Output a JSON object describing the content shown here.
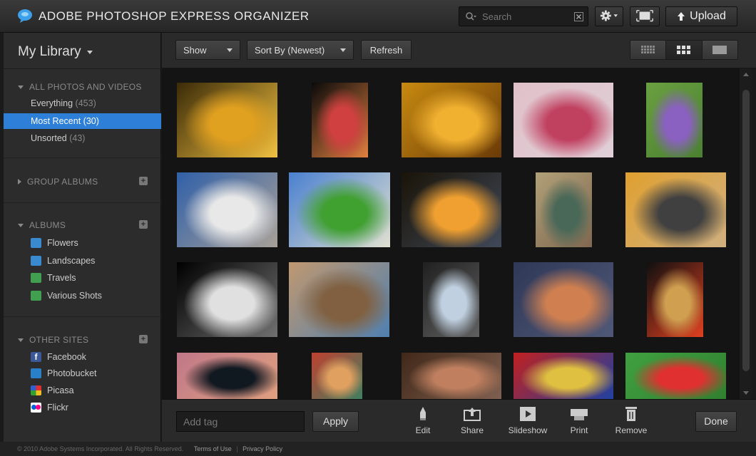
{
  "header": {
    "title": "ADOBE PHOTOSHOP EXPRESS ORGANIZER",
    "search_placeholder": "Search",
    "upload_label": "Upload",
    "logo_icon": "photoshop-express-logo",
    "accent": "#2d7fd8"
  },
  "sidebar": {
    "library_title": "My Library",
    "all_section": {
      "title": "ALL PHOTOS AND VIDEOS",
      "items": [
        {
          "label": "Everything",
          "count": "(453)"
        },
        {
          "label": "Most Recent",
          "count": "(30)",
          "selected": true
        },
        {
          "label": "Unsorted",
          "count": "(43)"
        }
      ]
    },
    "group_albums": {
      "title": "GROUP ALBUMS"
    },
    "albums": {
      "title": "ALBUMS",
      "items": [
        {
          "label": "Flowers",
          "icon": "album-icon"
        },
        {
          "label": "Landscapes",
          "icon": "album-icon"
        },
        {
          "label": "Travels",
          "icon": "album-icon"
        },
        {
          "label": "Various Shots",
          "icon": "album-icon"
        }
      ]
    },
    "other_sites": {
      "title": "OTHER SITES",
      "items": [
        {
          "label": "Facebook",
          "icon": "facebook-icon"
        },
        {
          "label": "Photobucket",
          "icon": "photobucket-icon"
        },
        {
          "label": "Picasa",
          "icon": "picasa-icon"
        },
        {
          "label": "Flickr",
          "icon": "flickr-icon"
        }
      ]
    }
  },
  "toolbar": {
    "show_label": "Show",
    "sort_label": "Sort By (Newest)",
    "refresh_label": "Refresh",
    "view_modes": [
      "small-thumbnails",
      "medium-thumbnails",
      "large-view"
    ],
    "active_view": "medium-thumbnails"
  },
  "grid": {
    "photos": [
      {
        "name": "yellow-flower",
        "colors": [
          "#3a2a08",
          "#e0a020",
          "#f0c040"
        ]
      },
      {
        "name": "red-tulips",
        "colors": [
          "#0a0a0a",
          "#d04040",
          "#e08040"
        ]
      },
      {
        "name": "paper-umbrella",
        "colors": [
          "#c88a10",
          "#f0b030",
          "#6a3a08"
        ]
      },
      {
        "name": "orchid",
        "colors": [
          "#e0c0c8",
          "#c04060",
          "#e0d0d8"
        ]
      },
      {
        "name": "purple-daisy",
        "colors": [
          "#6aa040",
          "#8a60c0",
          "#4a8030"
        ]
      },
      {
        "name": "arch-building",
        "colors": [
          "#3060a8",
          "#e8e8e8",
          "#a8a098"
        ]
      },
      {
        "name": "white-church",
        "colors": [
          "#4a80d0",
          "#40a030",
          "#e0e0d0"
        ]
      },
      {
        "name": "pagoda-sunset",
        "colors": [
          "#1a1408",
          "#f0a030",
          "#404858"
        ]
      },
      {
        "name": "green-doors",
        "colors": [
          "#b0a078",
          "#4a6858",
          "#806850"
        ]
      },
      {
        "name": "fisherman",
        "colors": [
          "#e0a030",
          "#404040",
          "#d0b080"
        ]
      },
      {
        "name": "boat-silhouette",
        "colors": [
          "#000000",
          "#e0e0e0",
          "#707070"
        ]
      },
      {
        "name": "old-street",
        "colors": [
          "#c09870",
          "#806040",
          "#5080b0"
        ]
      },
      {
        "name": "temple-arch",
        "colors": [
          "#202020",
          "#c0d0e0",
          "#606060"
        ]
      },
      {
        "name": "cloudy-sky",
        "colors": [
          "#303858",
          "#d08050",
          "#505878"
        ]
      },
      {
        "name": "window-autumn",
        "colors": [
          "#101010",
          "#d0a050",
          "#e04020"
        ]
      },
      {
        "name": "lake-trees",
        "colors": [
          "#c07888",
          "#101820",
          "#e0a080"
        ]
      },
      {
        "name": "woven-fabric",
        "colors": [
          "#c04030",
          "#e0a060",
          "#408060"
        ]
      },
      {
        "name": "pottery-hands",
        "colors": [
          "#402818",
          "#c08060",
          "#806050"
        ]
      },
      {
        "name": "red-masks",
        "colors": [
          "#c02020",
          "#e0c040",
          "#2040a0"
        ]
      },
      {
        "name": "green-red-field",
        "colors": [
          "#40a040",
          "#e03030",
          "#308030"
        ]
      }
    ]
  },
  "bottom": {
    "tag_placeholder": "Add tag",
    "apply_label": "Apply",
    "actions": [
      {
        "label": "Edit",
        "icon": "pen-icon"
      },
      {
        "label": "Share",
        "icon": "share-icon"
      },
      {
        "label": "Slideshow",
        "icon": "play-icon"
      },
      {
        "label": "Print",
        "icon": "print-icon"
      },
      {
        "label": "Remove",
        "icon": "trash-icon"
      }
    ],
    "done_label": "Done"
  },
  "footer": {
    "copyright": "© 2010 Adobe Systems Incorporated. All Rights Reserved.",
    "terms": "Terms of Use",
    "privacy": "Privacy Policy"
  }
}
